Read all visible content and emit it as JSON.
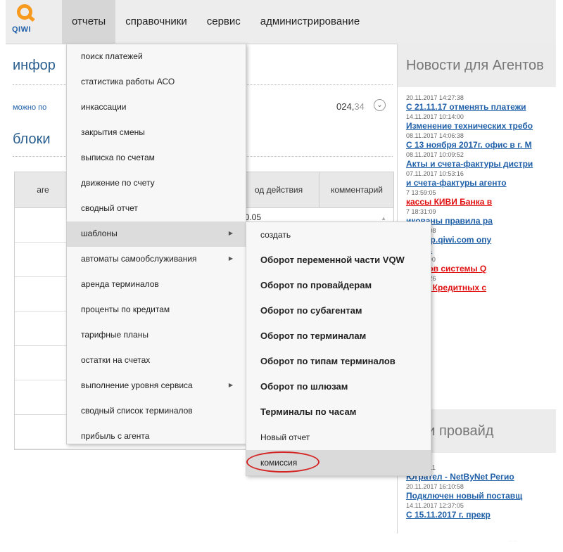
{
  "logo": {
    "word": "QIWI"
  },
  "nav": [
    {
      "label": "отчеты"
    },
    {
      "label": "справочники"
    },
    {
      "label": "сервис"
    },
    {
      "label": "администрирование"
    }
  ],
  "main": {
    "info_heading": "инфор",
    "can_text": "можно по",
    "amount_int": "024,",
    "amount_dec": "34",
    "block_heading": "блоки",
    "table": {
      "col_agent": "аге",
      "col_action": "од действия",
      "col_comment": "комментарий",
      "first_cell": "10.05"
    }
  },
  "menu": {
    "items": [
      {
        "label": "поиск платежей"
      },
      {
        "label": "статистика работы АСО"
      },
      {
        "label": "инкассации"
      },
      {
        "label": "закрытия смены"
      },
      {
        "label": "выписка по счетам"
      },
      {
        "label": "движение по счету"
      },
      {
        "label": "сводный отчет"
      },
      {
        "label": "шаблоны"
      },
      {
        "label": "автоматы самообслуживания"
      },
      {
        "label": "аренда терминалов"
      },
      {
        "label": "проценты по кредитам"
      },
      {
        "label": "тарифные планы"
      },
      {
        "label": "остатки на счетах"
      },
      {
        "label": "выполнение уровня сервиса"
      },
      {
        "label": "сводный список терминалов"
      },
      {
        "label": "прибыль с агента"
      }
    ],
    "submenu": [
      {
        "label": "создать"
      },
      {
        "label": "Оборот переменной части VQW"
      },
      {
        "label": "Оборот по провайдерам"
      },
      {
        "label": "Оборот по субагентам"
      },
      {
        "label": "Оборот по терминалам"
      },
      {
        "label": "Оборот по типам терминалов"
      },
      {
        "label": "Оборот по шлюзам"
      },
      {
        "label": "Терминалы по часам"
      },
      {
        "label": "Новый отчет"
      },
      {
        "label": "комиссия"
      }
    ]
  },
  "news": {
    "title": "Новости для Агентов",
    "items": [
      {
        "date": "20.11.2017 14:27:38",
        "title": "С 21.11.17 отменять платежи"
      },
      {
        "date": "14.11.2017 10:14:00",
        "title": "Изменение технических требо"
      },
      {
        "date": "08.11.2017 14:06:38",
        "title": "С 13 ноября 2017г. офис в г. М"
      },
      {
        "date": "08.11.2017 10:09:52",
        "title": "Акты и счета-фактуры дистри"
      },
      {
        "date": "07.11.2017 10:53:16",
        "title": "и счета-фактуры агенто"
      },
      {
        "date": "7 13:59:05",
        "title": "кассы КИВИ Банка в"
      },
      {
        "date": "7 18:31:09",
        "title": "икованы правила ра"
      },
      {
        "date": "7 18:26:08",
        "title": "те corp.qiwi.com опу",
        "title2": "2017 г."
      },
      {
        "date": "7 11:32:00",
        "title": "агентов системы Q"
      },
      {
        "date": "7 10:49:26",
        "title": "ентов Кредитных с"
      }
    ],
    "title2": "ости провайд",
    "items2": [
      {
        "date": "7 16:12:11",
        "title": "Югрател - NetByNet Регио"
      },
      {
        "date": "20.11.2017 16:10:58",
        "title": "Подключен новый поставщ"
      },
      {
        "date": "14.11.2017 12:37:05",
        "title": "С 15.11.2017 г. прекр"
      }
    ]
  }
}
